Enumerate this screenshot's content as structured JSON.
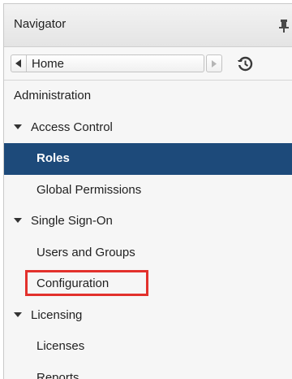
{
  "header": {
    "title": "Navigator"
  },
  "navbar": {
    "back_label": "Home"
  },
  "tree": {
    "administration": "Administration",
    "access_control": "Access Control",
    "roles": "Roles",
    "global_permissions": "Global Permissions",
    "single_sign_on": "Single Sign-On",
    "users_and_groups": "Users and Groups",
    "configuration": "Configuration",
    "licensing": "Licensing",
    "licenses": "Licenses",
    "reports": "Reports"
  },
  "colors": {
    "selected_bg": "#1d4a7a",
    "highlight": "#e2312c"
  },
  "icons": {
    "pin": "pin-icon",
    "back": "back-arrow-icon",
    "forward": "forward-arrow-icon",
    "history": "history-icon",
    "caret": "caret-down-icon"
  }
}
